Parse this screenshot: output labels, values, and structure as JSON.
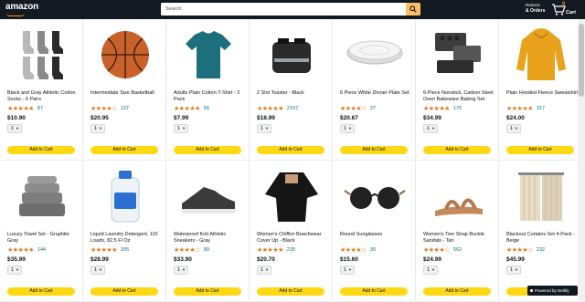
{
  "header": {
    "logo": "amazon",
    "search_placeholder": "Search",
    "returns_line1": "Returns",
    "returns_line2": "& Orders",
    "cart_count": "0",
    "cart_label": "Cart"
  },
  "products": [
    {
      "title": "Black and Gray Athletic Cotton Socks - 6 Pairs",
      "stars": "★★★★★",
      "rating": 4.5,
      "reviews": "87",
      "price": "$10.90",
      "qty": "1",
      "button": "Add to Cart",
      "icon": "socks-image"
    },
    {
      "title": "Intermediate Size Basketball",
      "stars": "★★★★☆",
      "rating": 4.0,
      "reviews": "127",
      "price": "$20.95",
      "qty": "1",
      "button": "Add to Cart",
      "icon": "basketball-image"
    },
    {
      "title": "Adults Plain Cotton T-Shirt - 2 Pack",
      "stars": "★★★★★",
      "rating": 4.5,
      "reviews": "56",
      "price": "$7.99",
      "qty": "1",
      "button": "Add to Cart",
      "icon": "tshirt-image"
    },
    {
      "title": "2 Slot Toaster - Black",
      "stars": "★★★★★",
      "rating": 5.0,
      "reviews": "2197",
      "price": "$18.99",
      "qty": "1",
      "button": "Add to Cart",
      "icon": "toaster-image"
    },
    {
      "title": "6 Piece White Dinner Plate Set",
      "stars": "★★★★☆",
      "rating": 4.0,
      "reviews": "37",
      "price": "$20.67",
      "qty": "1",
      "button": "Add to Cart",
      "icon": "plates-image"
    },
    {
      "title": "6-Piece Nonstick, Carbon Steel Oven Bakeware Baking Set",
      "stars": "★★★★★",
      "rating": 4.5,
      "reviews": "175",
      "price": "$34.99",
      "qty": "1",
      "button": "Add to Cart",
      "icon": "bakeware-image"
    },
    {
      "title": "Plain Hooded Fleece Sweatshirt",
      "stars": "★★★★★",
      "rating": 4.5,
      "reviews": "317",
      "price": "$24.00",
      "qty": "1",
      "button": "Add to Cart",
      "icon": "hoodie-image"
    },
    {
      "title": "Luxury Towel Set - Graphite Gray",
      "stars": "★★★★★",
      "rating": 4.5,
      "reviews": "144",
      "price": "$35.99",
      "qty": "1",
      "button": "Add to Cart",
      "icon": "towels-image"
    },
    {
      "title": "Liquid Laundry Detergent, 110 Loads, 82.5 Fl Oz",
      "stars": "★★★★★",
      "rating": 4.5,
      "reviews": "305",
      "price": "$28.99",
      "qty": "1",
      "button": "Add to Cart",
      "icon": "detergent-image"
    },
    {
      "title": "Waterproof Knit Athletic Sneakers - Gray",
      "stars": "★★★★☆",
      "rating": 4.0,
      "reviews": "89",
      "price": "$33.90",
      "qty": "1",
      "button": "Add to Cart",
      "icon": "sneaker-image"
    },
    {
      "title": "Women's Chiffon Beachwear Cover Up - Black",
      "stars": "★★★★★",
      "rating": 4.5,
      "reviews": "235",
      "price": "$20.70",
      "qty": "1",
      "button": "Add to Cart",
      "icon": "coverup-image"
    },
    {
      "title": "Round Sunglasses",
      "stars": "★★★★☆",
      "rating": 4.5,
      "reviews": "30",
      "price": "$15.60",
      "qty": "1",
      "button": "Add to Cart",
      "icon": "sunglasses-image"
    },
    {
      "title": "Women's Two Strap Buckle Sandals - Tan",
      "stars": "★★★★☆",
      "rating": 4.5,
      "reviews": "562",
      "price": "$24.99",
      "qty": "1",
      "button": "Add to Cart",
      "icon": "sandal-image"
    },
    {
      "title": "Blackout Curtains Set 4-Pack - Beige",
      "stars": "★★★★☆",
      "rating": 4.5,
      "reviews": "232",
      "price": "$45.99",
      "qty": "1",
      "button": "Add to Cart",
      "icon": "curtains-image"
    }
  ],
  "badge": "Powered by Netlify",
  "colors": {
    "header_bg": "#131921",
    "accent": "#ff9900",
    "button_yellow": "#ffd814",
    "star": "#de7921",
    "link": "#007185"
  }
}
